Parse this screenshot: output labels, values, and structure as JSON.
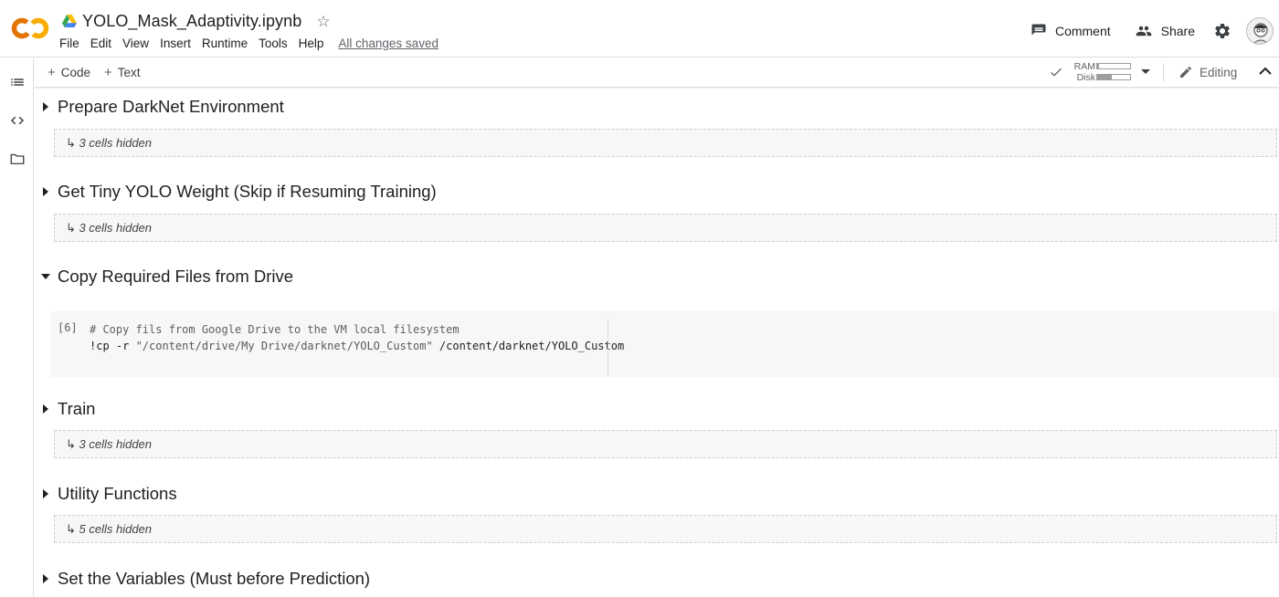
{
  "app": {
    "logo": "CO",
    "doc_title": "YOLO_Mask_Adaptivity.ipynb",
    "save_status": "All changes saved"
  },
  "menu": [
    "File",
    "Edit",
    "View",
    "Insert",
    "Runtime",
    "Tools",
    "Help"
  ],
  "header_actions": {
    "comment": "Comment",
    "share": "Share"
  },
  "toolbar": {
    "add_code": "Code",
    "add_text": "Text",
    "ram_label": "RAM",
    "disk_label": "Disk",
    "ram_usage": 0.05,
    "disk_usage": 0.45,
    "mode_label": "Editing"
  },
  "sections": [
    {
      "title": "Prepare DarkNet Environment",
      "expanded": false,
      "hidden_text": "↳ 3 cells hidden"
    },
    {
      "title": "Get Tiny YOLO Weight (Skip if Resuming Training)",
      "expanded": false,
      "hidden_text": "↳ 3 cells hidden"
    },
    {
      "title": "Copy Required Files from Drive",
      "expanded": true
    },
    {
      "title": "Train",
      "expanded": false,
      "hidden_text": "↳ 3 cells hidden"
    },
    {
      "title": "Utility Functions",
      "expanded": false,
      "hidden_text": "↳ 5 cells hidden"
    },
    {
      "title": "Set the Variables (Must before Prediction)",
      "expanded": false
    }
  ],
  "code_cell": {
    "exec_count": "[6]",
    "line1": "# Copy fils from Google Drive to the VM local filesystem",
    "line2_cmd": "!cp -r ",
    "line2_src": "\"/content/drive/My Drive/darknet/YOLO_Custom\"",
    "line2_dst": " /content/darknet/YOLO_Custom"
  },
  "colors": {
    "logo_orange": "#F9AB00",
    "logo_dark": "#E37400",
    "hidden_bg": "#f7f7f7",
    "text": "#212121"
  }
}
